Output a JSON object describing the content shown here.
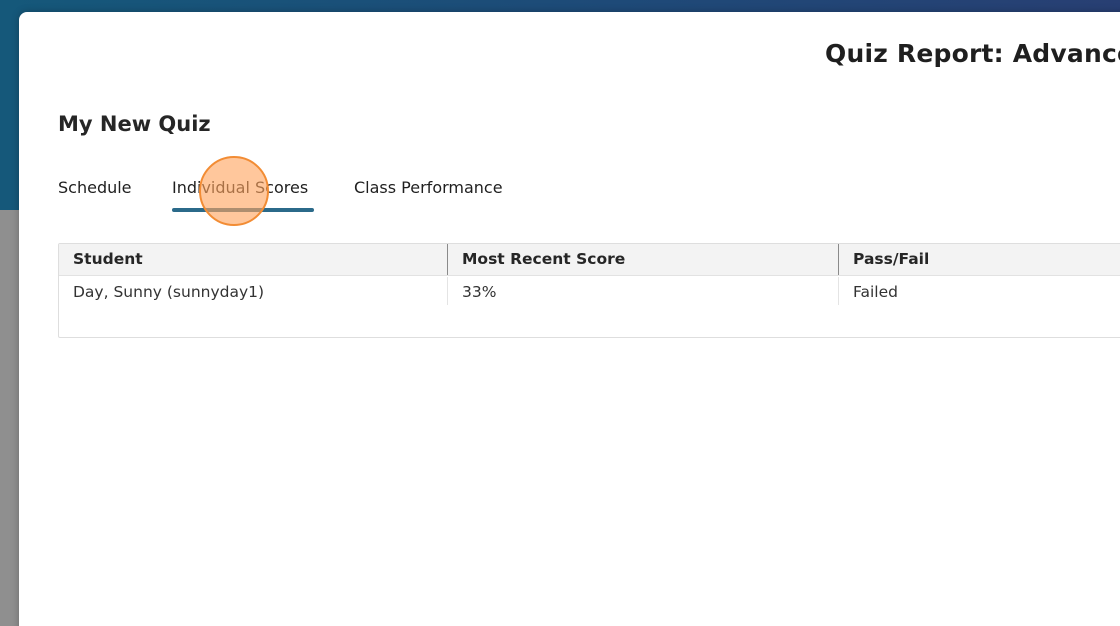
{
  "modal": {
    "title": "Quiz Report: Advanced"
  },
  "quiz": {
    "name": "My New Quiz"
  },
  "tabs": [
    {
      "label": "Schedule",
      "active": false
    },
    {
      "label": "Individual Scores",
      "active": true
    },
    {
      "label": "Class Performance",
      "active": false
    }
  ],
  "table": {
    "columns": [
      "Student",
      "Most Recent Score",
      "Pass/Fail"
    ],
    "rows": [
      [
        "Day, Sunny (sunnyday1)",
        "33%",
        "Failed"
      ]
    ]
  },
  "colors": {
    "tab_indicator": "#2b6a8a",
    "click_marker": "#f28c34"
  }
}
